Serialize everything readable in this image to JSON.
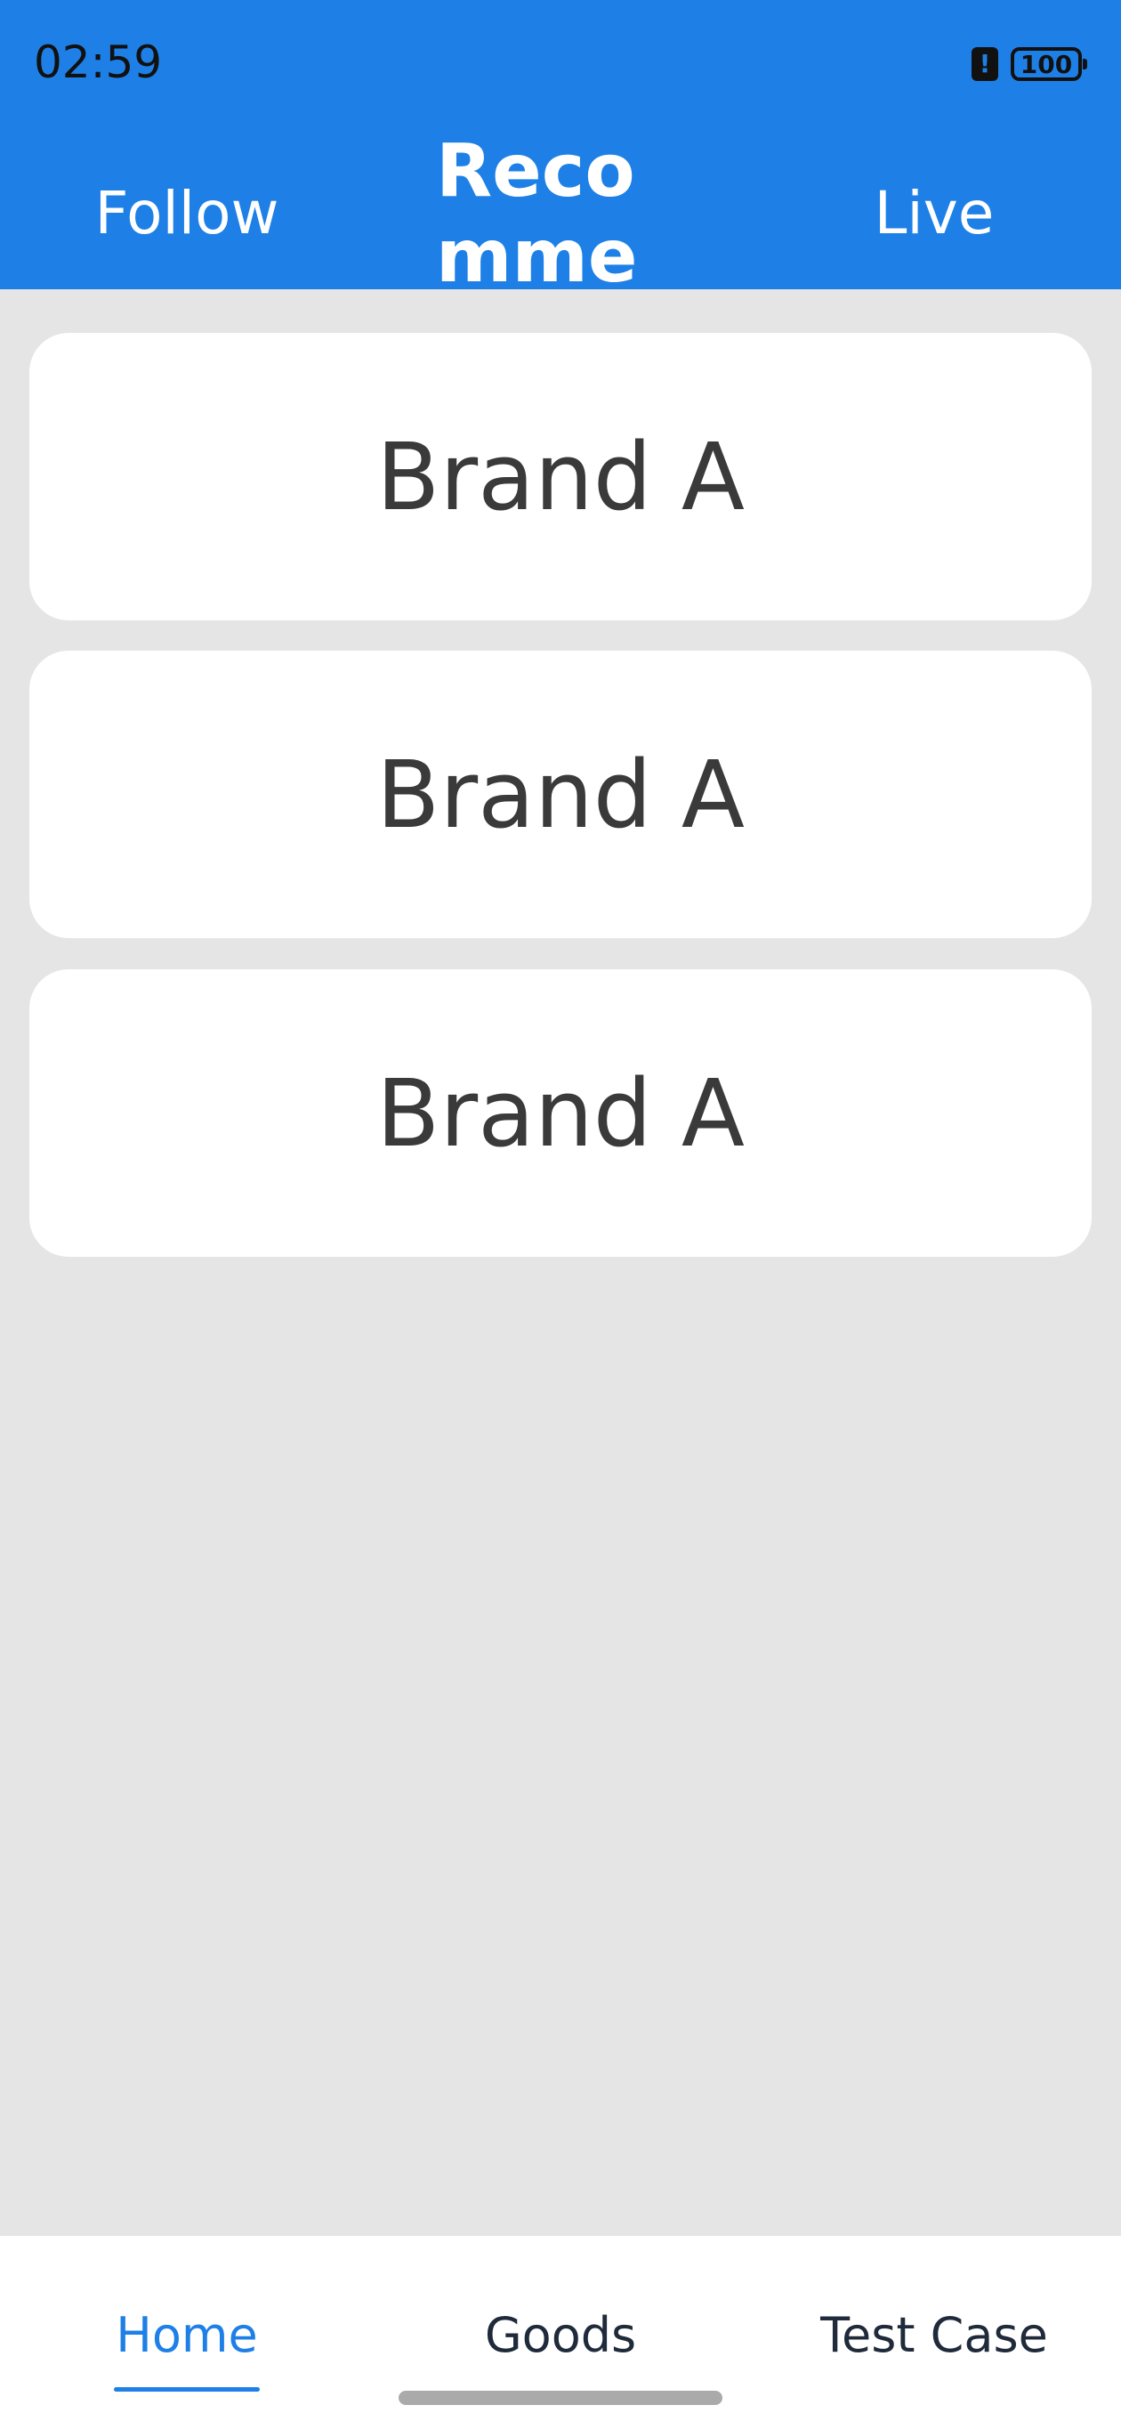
{
  "status_bar": {
    "time": "02:59",
    "battery_alert": "!",
    "battery_level": "100",
    "battery_icon": "battery-icon",
    "alert_icon": "battery-alert-icon"
  },
  "top_tabs": {
    "follow": "Follow",
    "recommend": "Recommend",
    "live": "Live",
    "active": "recommend"
  },
  "cards": [
    {
      "label": "Brand A"
    },
    {
      "label": "Brand A"
    },
    {
      "label": "Brand A"
    }
  ],
  "bottom_nav": {
    "home": "Home",
    "goods": "Goods",
    "test_case": "Test Case",
    "active": "home"
  },
  "colors": {
    "header": "#1e80e6",
    "background": "#e5e5e5",
    "card": "#ffffff",
    "active_tab": "#1e80e6",
    "card_text": "#3a3a3a"
  }
}
